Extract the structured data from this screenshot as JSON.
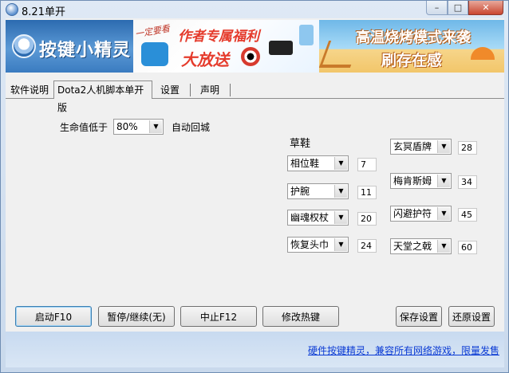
{
  "window": {
    "title": "8.21单开",
    "controls": {
      "minimize": "–",
      "maximize": "□",
      "close": "✕"
    }
  },
  "banner": {
    "logo_text": "按键小精灵",
    "ad1": {
      "handwritten": "一定要看",
      "line1": "作者专属福利",
      "line2": "大放送"
    },
    "ad2": {
      "line1": "高温烧烤模式来袭",
      "line2": "刷存在感"
    }
  },
  "tabs": [
    {
      "label": "软件说明"
    },
    {
      "label": "Dota2人机脚本单开版"
    },
    {
      "label": "设置"
    },
    {
      "label": "声明"
    }
  ],
  "health": {
    "label": "生命值低于",
    "value": "80%",
    "suffix": "自动回城"
  },
  "boots": {
    "title": "草鞋",
    "items": [
      {
        "name": "相位鞋",
        "num": "7"
      },
      {
        "name": "护腕",
        "num": "11"
      },
      {
        "name": "幽魂权杖",
        "num": "20"
      },
      {
        "name": "恢复头巾",
        "num": "24"
      }
    ]
  },
  "items_right": [
    {
      "name": "玄冥盾牌",
      "num": "28"
    },
    {
      "name": "梅肯斯姆",
      "num": "34"
    },
    {
      "name": "闪避护符",
      "num": "45"
    },
    {
      "name": "天堂之戟",
      "num": "60"
    }
  ],
  "buttons": {
    "start": "启动F10",
    "pause": "暂停/继续(无)",
    "stop": "中止F12",
    "hotkey": "修改热键",
    "save": "保存设置",
    "restore": "还原设置"
  },
  "footer_link": "硬件按键精灵，兼容所有网络游戏，限量发售"
}
